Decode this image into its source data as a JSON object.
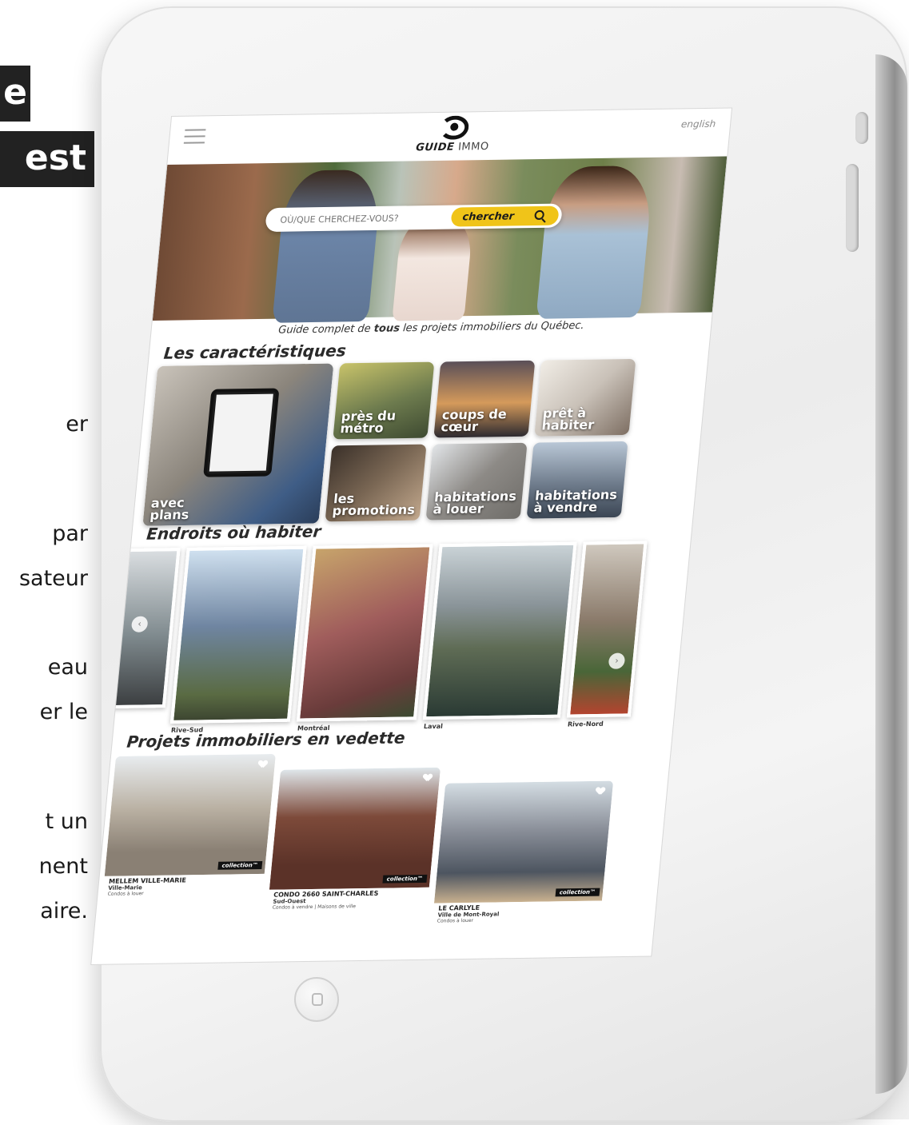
{
  "colors": {
    "accent": "#f0c419",
    "tag_background": "#222222",
    "tablet_body": "#f2f2f2"
  },
  "left_column": {
    "tag_lines": [
      "e",
      "est"
    ],
    "text_fragments": [
      "er",
      "par",
      "sateur",
      "eau",
      "er le",
      "t un",
      "nent",
      "aire."
    ]
  },
  "site": {
    "logo": {
      "brand": "GUIDE",
      "suffix": "IMMO",
      "icon": "guide-immo-logo-icon"
    },
    "lang_link": "english",
    "menu_icon": "hamburger-menu-icon",
    "search": {
      "placeholder": "OÙ/QUE CHERCHEZ-VOUS?",
      "button_label": "chercher",
      "icon": "search-icon"
    },
    "tagline": {
      "before": "Guide complet de ",
      "bold": "tous",
      "after": " les projets immobiliers du Québec."
    },
    "features": {
      "title": "Les caractéristiques",
      "tiles": [
        {
          "label": "avec\nplans",
          "color": "#5f6e78"
        },
        {
          "label": "près du\nmétro",
          "color": "#6d7b4e"
        },
        {
          "label": "coups de\ncœur",
          "color": "#3d3a44"
        },
        {
          "label": "prêt à\nhabiter",
          "color": "#c9c1b8"
        },
        {
          "label": "les\npromotions",
          "color": "#7a6754"
        },
        {
          "label": "habitations\nà louer",
          "color": "#8d8a86"
        },
        {
          "label": "habitations\nà vendre",
          "color": "#6f7c8c"
        }
      ]
    },
    "places": {
      "title": "Endroits où habiter",
      "items": [
        {
          "caption": "",
          "color": "#7f8a8e"
        },
        {
          "caption": "Rive-Sud",
          "color": "#6f85a1"
        },
        {
          "caption": "Montréal",
          "color": "#a05d5c"
        },
        {
          "caption": "Laval",
          "color": "#5f6c55"
        },
        {
          "caption": "Rive-Nord",
          "color": "#8a7a6a"
        }
      ],
      "prev_icon": "chevron-left-icon",
      "next_icon": "chevron-right-icon"
    },
    "projects": {
      "title": "Projets immobiliers en vedette",
      "items": [
        {
          "name": "MELLEM VILLE-MARIE",
          "area": "Ville-Marie",
          "type": "Condos à louer",
          "badge": "collection™",
          "color": "#b9b0a2"
        },
        {
          "name": "CONDO 2660 SAINT-CHARLES",
          "area": "Sud-Ouest",
          "type": "Condos à vendre | Maisons de ville",
          "badge": "collection™",
          "color": "#7d4a3a"
        },
        {
          "name": "LE CARLYLE",
          "area": "Ville de Mont-Royal",
          "type": "Condos à louer",
          "badge": "collection™",
          "color": "#8a8f99"
        }
      ],
      "fav_icon": "heart-icon"
    }
  }
}
